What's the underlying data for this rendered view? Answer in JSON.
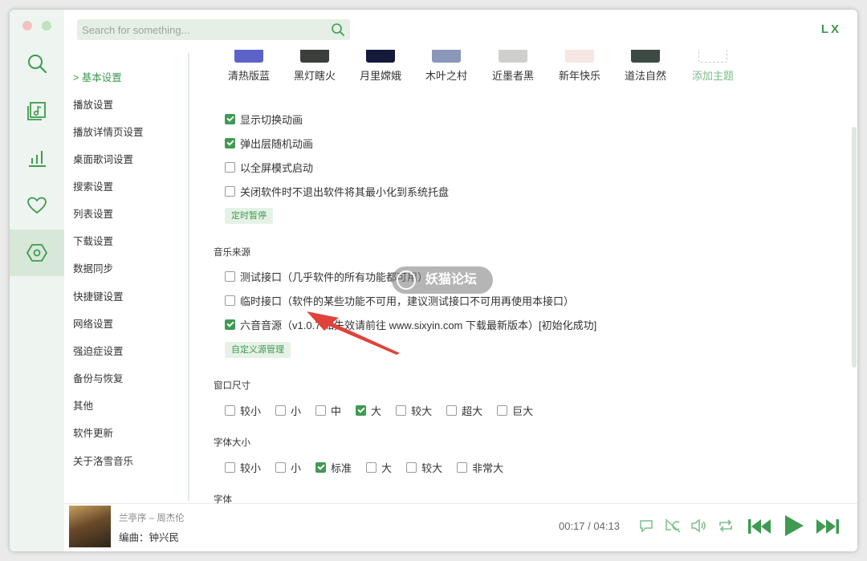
{
  "brand": "LX",
  "search": {
    "placeholder": "Search for something..."
  },
  "settings_menu": [
    {
      "label": "> 基本设置",
      "active": true
    },
    {
      "label": "播放设置"
    },
    {
      "label": "播放详情页设置"
    },
    {
      "label": "桌面歌词设置"
    },
    {
      "label": "搜索设置"
    },
    {
      "label": "列表设置"
    },
    {
      "label": "下载设置"
    },
    {
      "label": "数据同步"
    },
    {
      "label": "快捷键设置"
    },
    {
      "label": "网络设置"
    },
    {
      "label": "强迫症设置"
    },
    {
      "label": "备份与恢复"
    },
    {
      "label": "其他"
    },
    {
      "label": "软件更新"
    },
    {
      "label": "关于洛雪音乐"
    }
  ],
  "themes": [
    {
      "label": "清热版蓝",
      "color": "#5b63c9"
    },
    {
      "label": "黑灯瞎火",
      "color": "#3a3f3b"
    },
    {
      "label": "月里嫦娥",
      "color": "#141a3a"
    },
    {
      "label": "木叶之村",
      "color": "#8a97b8"
    },
    {
      "label": "近墨者黑",
      "color": "#cfcfcc"
    },
    {
      "label": "新年快乐",
      "color": "#f6e7e2"
    },
    {
      "label": "道法自然",
      "color": "#3d4a44"
    },
    {
      "label": "添加主题",
      "color": "#ffffff",
      "accent": true
    }
  ],
  "general": [
    {
      "label": "显示切换动画",
      "checked": true
    },
    {
      "label": "弹出层随机动画",
      "checked": true
    },
    {
      "label": "以全屏模式启动",
      "checked": false
    },
    {
      "label": "关闭软件时不退出软件将其最小化到系统托盘",
      "checked": false
    }
  ],
  "timer_button": "定时暂停",
  "music_source": {
    "title": "音乐来源",
    "options": [
      {
        "label": "测试接口（几乎软件的所有功能都可用）",
        "checked": false
      },
      {
        "label": "临时接口（软件的某些功能不可用，建议测试接口不可用再使用本接口）",
        "checked": false
      },
      {
        "label": "六音音源（v1.0.7 如失效请前往 www.sixyin.com 下载最新版本）[初始化成功]",
        "checked": true
      }
    ],
    "manage_button": "自定义源管理"
  },
  "window_size": {
    "title": "窗口尺寸",
    "options": [
      {
        "label": "较小",
        "checked": false
      },
      {
        "label": "小",
        "checked": false
      },
      {
        "label": "中",
        "checked": false
      },
      {
        "label": "大",
        "checked": true
      },
      {
        "label": "较大",
        "checked": false
      },
      {
        "label": "超大",
        "checked": false
      },
      {
        "label": "巨大",
        "checked": false
      }
    ]
  },
  "font_size": {
    "title": "字体大小",
    "options": [
      {
        "label": "较小",
        "checked": false
      },
      {
        "label": "小",
        "checked": false
      },
      {
        "label": "标准",
        "checked": true
      },
      {
        "label": "大",
        "checked": false
      },
      {
        "label": "较大",
        "checked": false
      },
      {
        "label": "非常大",
        "checked": false
      }
    ]
  },
  "font_title": "字体",
  "watermark": "妖猫论坛",
  "player": {
    "song": "兰亭序 – 周杰伦",
    "lyric": "编曲：钟兴民",
    "time_current": "00:17",
    "time_sep": "/",
    "time_total": "04:13"
  },
  "colors": {
    "accent": "#3f9a52",
    "sidebar": "#eef4ef"
  }
}
